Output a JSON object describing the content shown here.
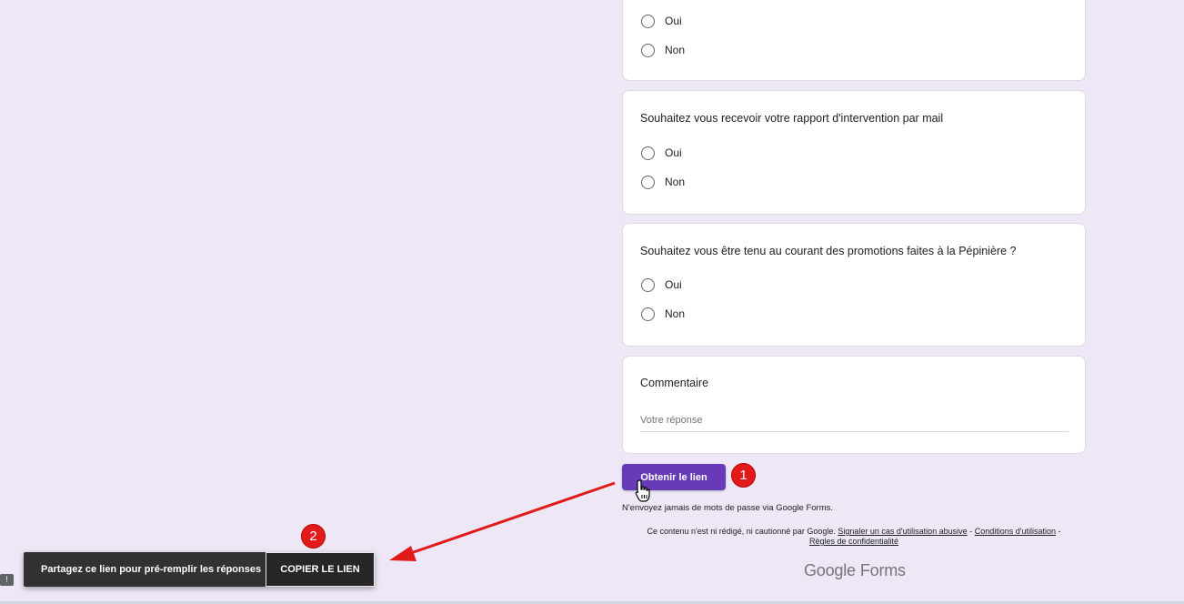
{
  "questions": [
    {
      "title": "",
      "options": [
        "Oui",
        "Non"
      ]
    },
    {
      "title": "Souhaitez vous recevoir votre rapport d'intervention par mail",
      "options": [
        "Oui",
        "Non"
      ]
    },
    {
      "title": "Souhaitez vous être tenu au courant des promotions faites à la Pépinière ?",
      "options": [
        "Oui",
        "Non"
      ]
    }
  ],
  "comment": {
    "title": "Commentaire",
    "placeholder": "Votre réponse"
  },
  "get_link_button": "Obtenir le lien",
  "password_note": "N'envoyez jamais de mots de passe via Google Forms.",
  "footer": {
    "disclaimer_prefix": "Ce contenu n'est ni rédigé, ni cautionné par Google.",
    "report_abuse": "Signaler un cas d'utilisation abusive",
    "separator": "-",
    "terms": "Conditions d'utilisation",
    "privacy": "Règles de confidentialité"
  },
  "logo": {
    "google": "Google",
    "forms": "Forms"
  },
  "toast": {
    "message": "Partagez ce lien pour pré-remplir les réponses",
    "action": "COPIER LE LIEN"
  },
  "annotations": {
    "step1": "1",
    "step2": "2"
  },
  "feedback_icon": "!",
  "colors": {
    "accent": "#673ab7",
    "background": "#ede7f6",
    "annotation_red": "#e21a1a",
    "toast_bg": "#323232"
  }
}
